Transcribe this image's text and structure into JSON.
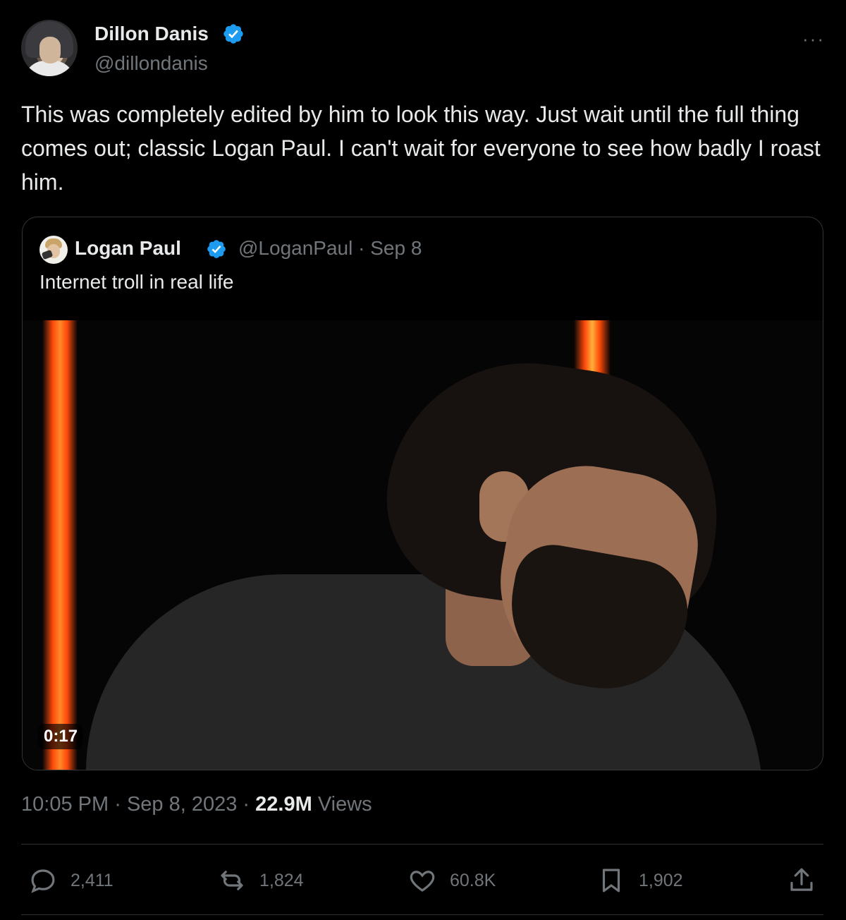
{
  "author": {
    "name": "Dillon Danis",
    "handle": "@dillondanis",
    "verified_icon": "verified-badge-icon",
    "more_label": "···"
  },
  "tweet": {
    "text": "This was completely edited by him to look this way. Just wait until the full thing comes out; classic Logan Paul. I can't wait for everyone to see how badly I roast him."
  },
  "quoted_tweet": {
    "name": "Logan Paul",
    "handle": "@LoganPaul",
    "separator": "·",
    "date": "Sep 8",
    "text": "Internet troll in real life",
    "video_duration": "0:17"
  },
  "meta": {
    "time": "10:05 PM",
    "separator": "·",
    "date": "Sep 8, 2023",
    "views_count": "22.9M",
    "views_label": "Views"
  },
  "actions": {
    "replies": "2,411",
    "reposts": "1,824",
    "likes": "60.8K",
    "bookmarks": "1,902"
  },
  "colors": {
    "background": "#000000",
    "text_primary": "#e7e9ea",
    "text_secondary": "#71767b",
    "verified_blue": "#1d9bf0",
    "border": "#333639",
    "neon_orange": "#ff4a0a"
  }
}
